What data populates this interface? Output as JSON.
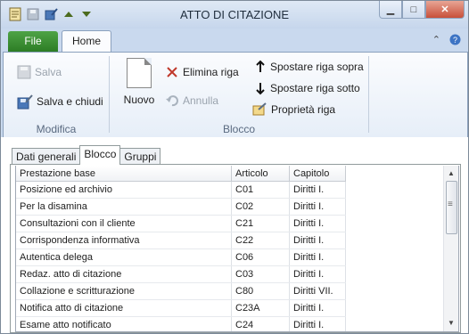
{
  "window": {
    "title": "ATTO DI CITAZIONE"
  },
  "ribbon_tabs": {
    "file": "File",
    "home": "Home"
  },
  "groups": {
    "modifica": {
      "label": "Modifica",
      "salva": "Salva",
      "salva_chiudi": "Salva e chiudi"
    },
    "blocco": {
      "label": "Blocco",
      "nuovo": "Nuovo",
      "elimina_riga": "Elimina riga",
      "annulla": "Annulla",
      "spostare_sopra": "Spostare riga sopra",
      "spostare_sotto": "Spostare riga sotto",
      "proprieta_riga": "Proprietà riga"
    }
  },
  "inner_tabs": [
    "Dati generali",
    "Blocco",
    "Gruppi"
  ],
  "table": {
    "columns": [
      "Prestazione base",
      "Articolo",
      "Capitolo"
    ],
    "rows": [
      [
        "Posizione ed archivio",
        "C01",
        "Diritti I."
      ],
      [
        "Per la disamina",
        "C02",
        "Diritti I."
      ],
      [
        "Consultazioni con il cliente",
        "C21",
        "Diritti I."
      ],
      [
        "Corrispondenza informativa",
        "C22",
        "Diritti I."
      ],
      [
        "Autentica delega",
        "C06",
        "Diritti I."
      ],
      [
        "Redaz. atto di citazione",
        "C03",
        "Diritti I."
      ],
      [
        "Collazione e scritturazione",
        "C80",
        "Diritti VII."
      ],
      [
        "Notifica atto di citazione",
        "C23A",
        "Diritti I."
      ],
      [
        "Esame atto notificato",
        "C24",
        "Diritti I."
      ]
    ]
  }
}
